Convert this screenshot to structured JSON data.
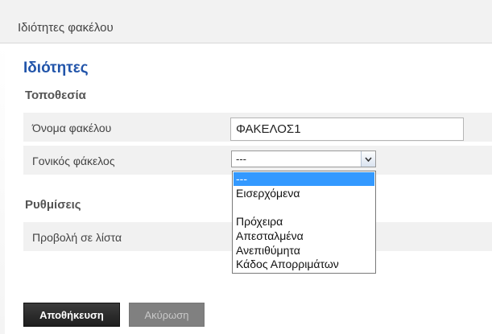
{
  "dialog": {
    "title": "Ιδιότητες φακέλου"
  },
  "section": {
    "title": "Ιδιότητες"
  },
  "location": {
    "title": "Τοποθεσία",
    "folder_name_label": "Όνομα φακέλου",
    "folder_name_value": "ΦΑΚΕΛΟΣ1",
    "parent_folder_label": "Γονικός φάκελος",
    "parent_folder_value": "---"
  },
  "dropdown": {
    "options": [
      "---",
      "Εισερχόμενα",
      "",
      "Πρόχειρα",
      "Απεσταλμένα",
      "Ανεπιθύμητα",
      "Κάδος Απορριμάτων"
    ],
    "selected_index": 0
  },
  "settings": {
    "title": "Ρυθμίσεις",
    "list_view_label": "Προβολή σε λίστα"
  },
  "buttons": {
    "save": "Αποθήκευση",
    "cancel": "Ακύρωση"
  },
  "icons": {
    "dropdown_arrow": "chevron-down-icon"
  },
  "colors": {
    "accent": "#2255aa",
    "selection": "#3399ff"
  }
}
